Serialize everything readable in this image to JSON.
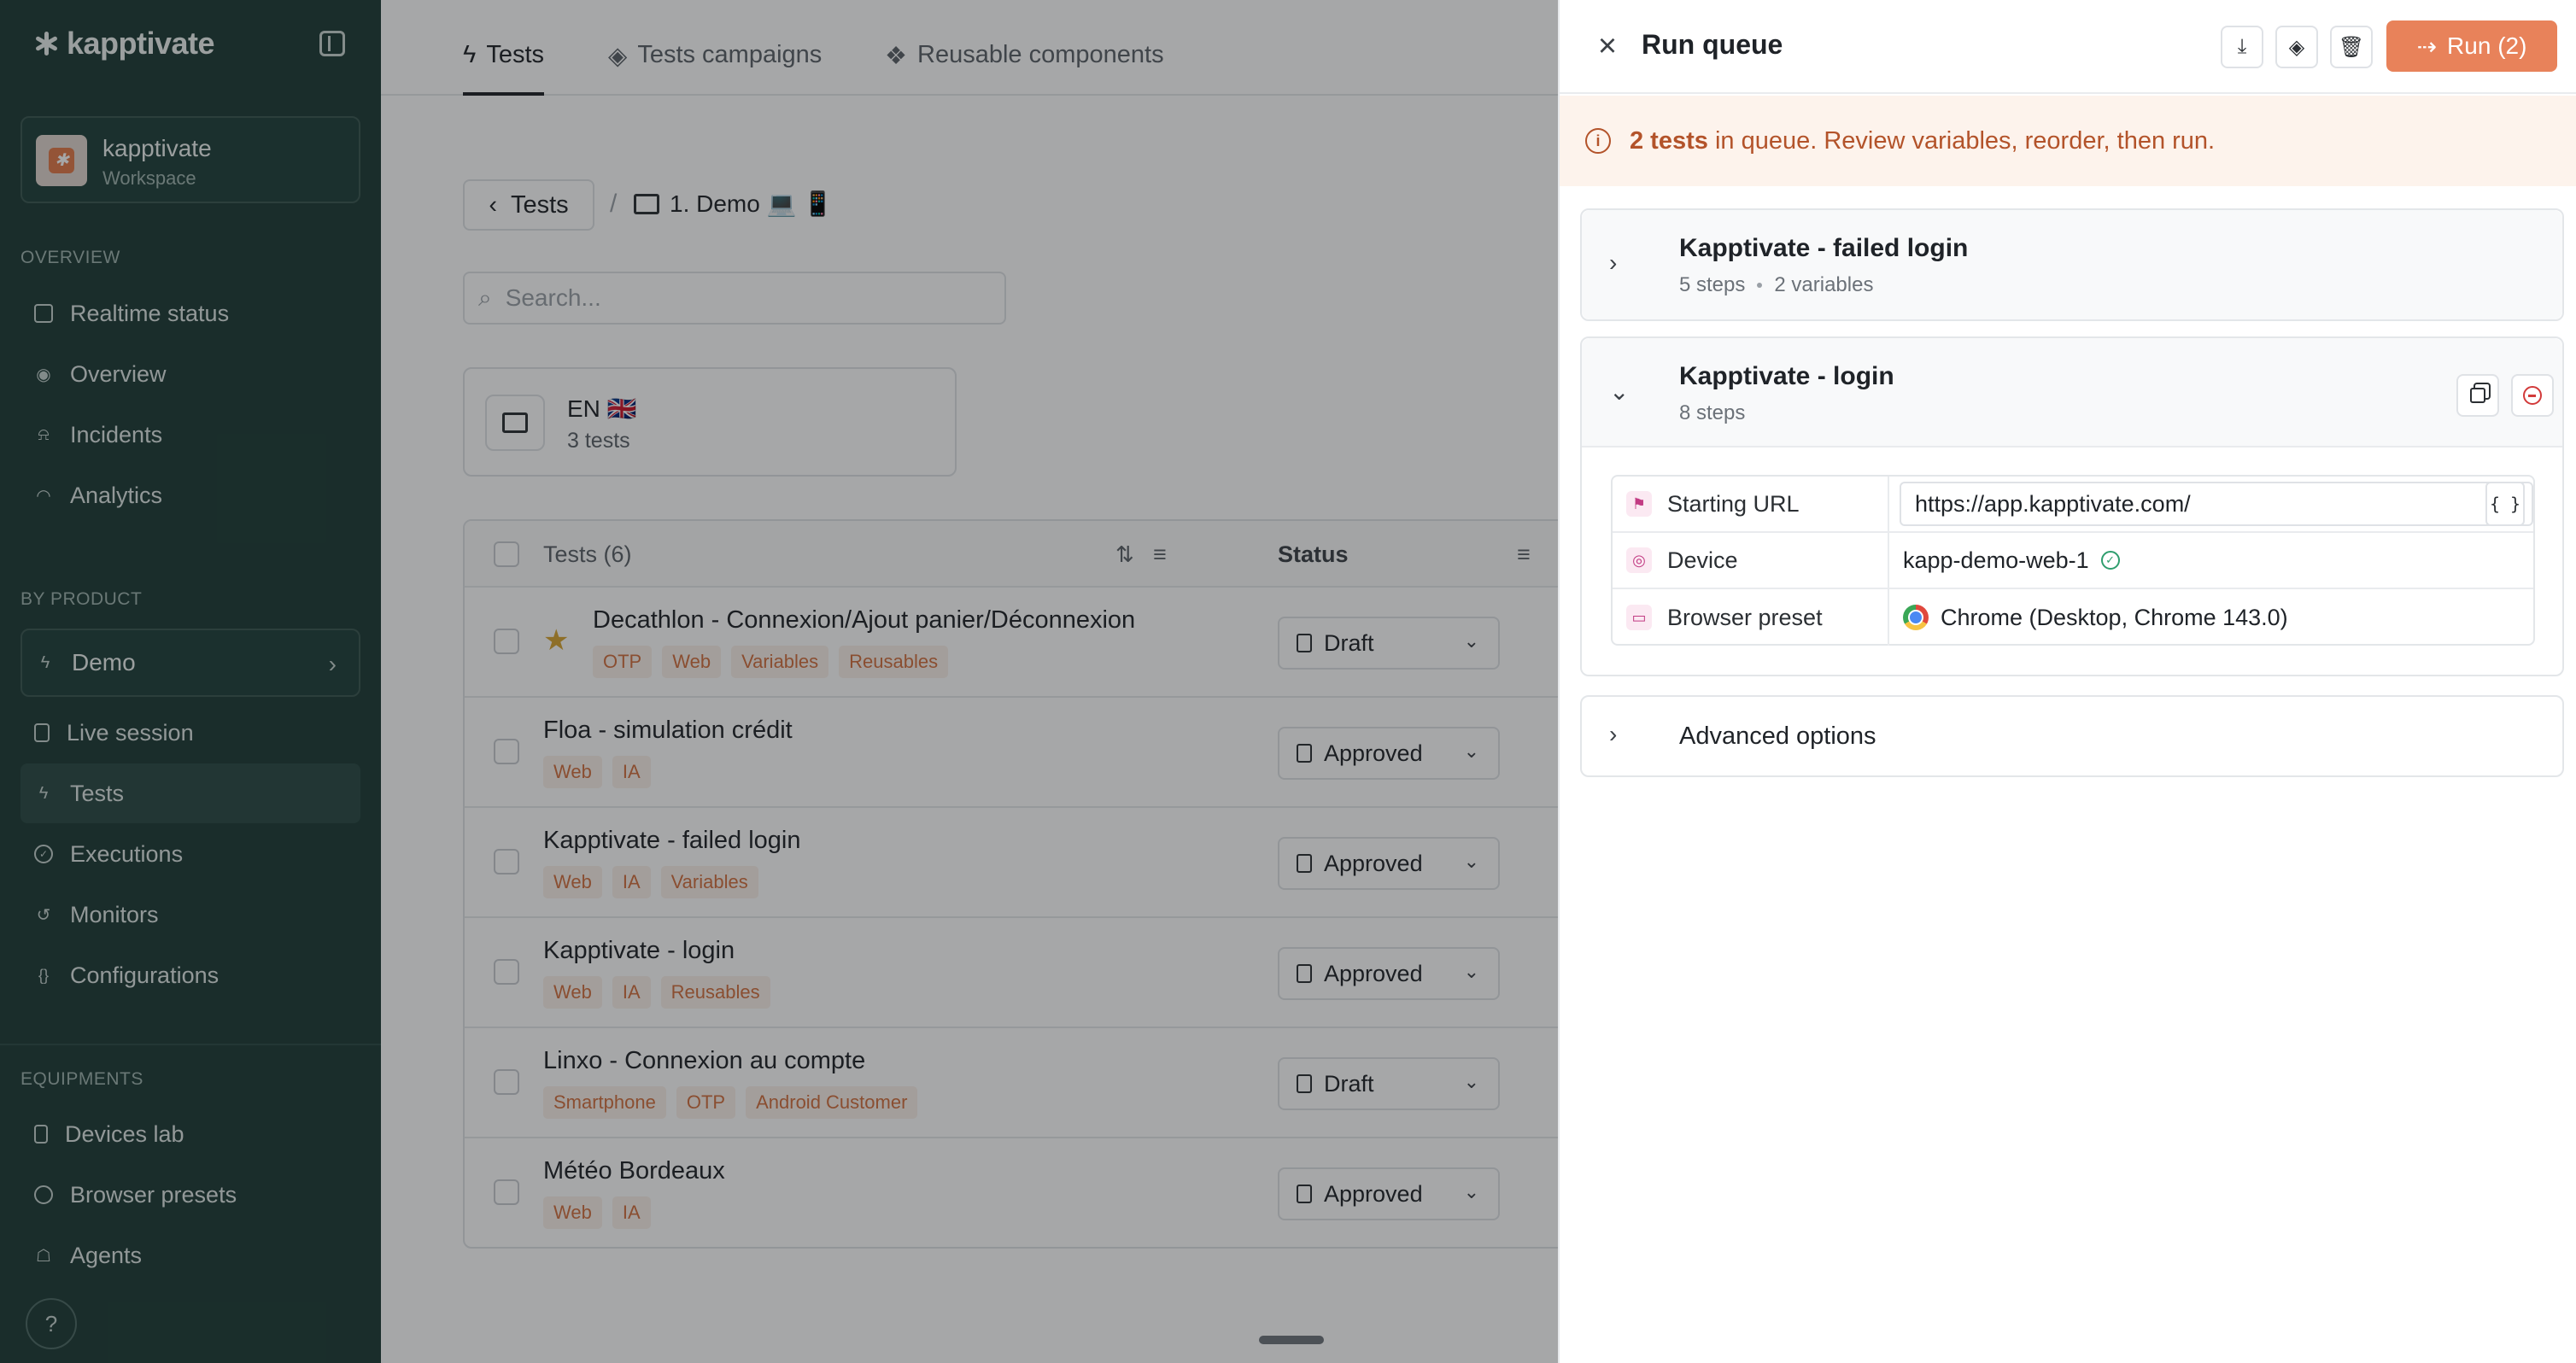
{
  "sidebar": {
    "brand": "kapptivate",
    "workspace": {
      "name": "kapptivate",
      "subtitle": "Workspace"
    },
    "overview_label": "OVERVIEW",
    "overview_items": [
      {
        "label": "Realtime status",
        "icon": "monitor-icon"
      },
      {
        "label": "Overview",
        "icon": "eye-icon"
      },
      {
        "label": "Incidents",
        "icon": "bell-icon"
      },
      {
        "label": "Analytics",
        "icon": "gauge-icon"
      }
    ],
    "product_label": "BY PRODUCT",
    "product_select": "Demo",
    "product_items": [
      {
        "label": "Live session",
        "icon": "phone-icon"
      },
      {
        "label": "Tests",
        "icon": "bolt-icon",
        "active": true
      },
      {
        "label": "Executions",
        "icon": "check-circle-icon"
      },
      {
        "label": "Monitors",
        "icon": "history-icon"
      },
      {
        "label": "Configurations",
        "icon": "braces-icon"
      }
    ],
    "equipments_label": "EQUIPMENTS",
    "equipment_items": [
      {
        "label": "Devices lab",
        "icon": "smartphone-icon"
      },
      {
        "label": "Browser presets",
        "icon": "chrome-icon"
      },
      {
        "label": "Agents",
        "icon": "robot-icon"
      }
    ],
    "help": "?"
  },
  "main": {
    "tabs": [
      {
        "label": "Tests",
        "active": true
      },
      {
        "label": "Tests campaigns"
      },
      {
        "label": "Reusable components"
      }
    ],
    "breadcrumb": {
      "back": "Tests",
      "separator": "/",
      "folder": "1. Demo 💻 📱"
    },
    "search_placeholder": "Search...",
    "folder_card": {
      "title": "EN 🇬🇧",
      "subtitle": "3 tests"
    },
    "table": {
      "header_tests": "Tests (6)",
      "header_status": "Status",
      "rows": [
        {
          "title": "Decathlon - Connexion/Ajout panier/Déconnexion",
          "tags": [
            "OTP",
            "Web",
            "Variables",
            "Reusables"
          ],
          "status": "Draft",
          "starred": true
        },
        {
          "title": "Floa - simulation crédit",
          "tags": [
            "Web",
            "IA"
          ],
          "status": "Approved"
        },
        {
          "title": "Kapptivate - failed login",
          "tags": [
            "Web",
            "IA",
            "Variables"
          ],
          "status": "Approved"
        },
        {
          "title": "Kapptivate - login",
          "tags": [
            "Web",
            "IA",
            "Reusables"
          ],
          "status": "Approved"
        },
        {
          "title": "Linxo - Connexion au compte",
          "tags": [
            "Smartphone",
            "OTP",
            "Android Customer"
          ],
          "status": "Draft"
        },
        {
          "title": "Météo Bordeaux",
          "tags": [
            "Web",
            "IA"
          ],
          "status": "Approved"
        }
      ]
    }
  },
  "panel": {
    "title": "Run queue",
    "run_label": "Run (2)",
    "banner": {
      "strong": "2 tests",
      "text": " in queue. Review variables, reorder, then run."
    },
    "queue": [
      {
        "title": "Kapptivate - failed login",
        "steps": "5 steps",
        "variables": "2 variables",
        "expanded": false
      },
      {
        "title": "Kapptivate - login",
        "steps": "8 steps",
        "expanded": true,
        "variables": [
          {
            "label": "Starting URL",
            "value": "https://app.kapptivate.com/",
            "var_button": "{ }"
          },
          {
            "label": "Device",
            "value": "kapp-demo-web-1"
          },
          {
            "label": "Browser preset",
            "value": "Chrome (Desktop, Chrome 143.0)"
          }
        ]
      }
    ],
    "advanced": "Advanced options"
  },
  "colors": {
    "sidebar_bg": "#1d3b36",
    "accent": "#e8825a",
    "tag_text": "#d2703f",
    "banner_bg": "#fdf3ec",
    "banner_text": "#b3532a"
  }
}
